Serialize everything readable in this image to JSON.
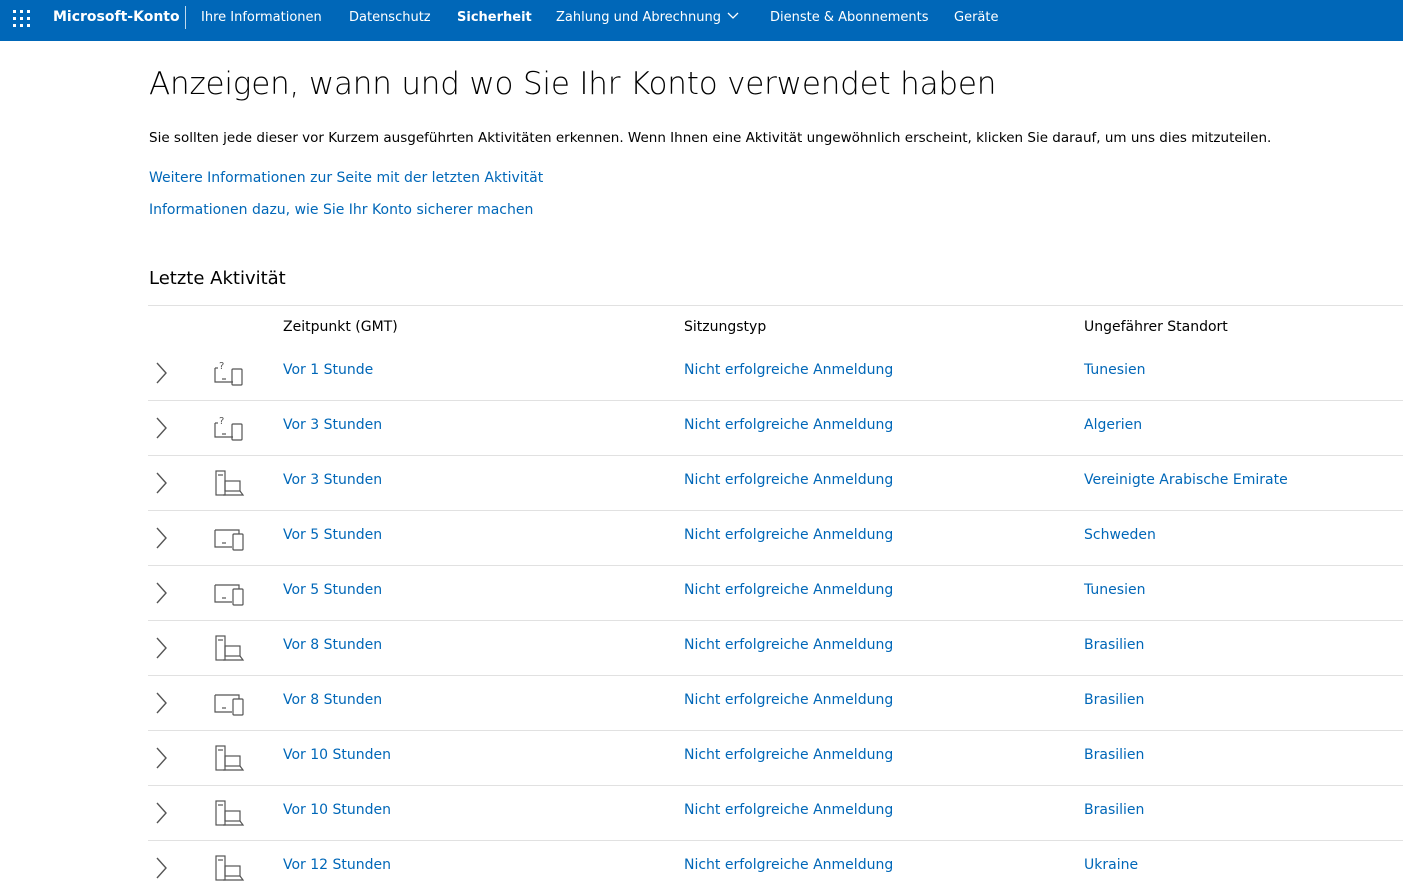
{
  "header": {
    "brand": "Microsoft-Konto",
    "nav": [
      {
        "label": "Ihre Informationen",
        "active": false
      },
      {
        "label": "Datenschutz",
        "active": false
      },
      {
        "label": "Sicherheit",
        "active": true
      },
      {
        "label": "Zahlung und Abrechnung",
        "active": false,
        "dropdown": true
      },
      {
        "label": "Dienste & Abonnements",
        "active": false
      },
      {
        "label": "Geräte",
        "active": false
      }
    ],
    "colors": {
      "bar": "#0067b8",
      "text": "#ffffff"
    }
  },
  "main": {
    "title": "Anzeigen, wann und wo Sie Ihr Konto verwendet haben",
    "intro": "Sie sollten jede dieser vor Kurzem ausgeführten Aktivitäten erkennen. Wenn Ihnen eine Aktivität ungewöhnlich erscheint, klicken Sie darauf, um uns dies mitzuteilen.",
    "links": [
      "Weitere Informationen zur Seite mit der letzten Aktivität",
      "Informationen dazu, wie Sie Ihr Konto sicherer machen"
    ],
    "section_title": "Letzte Aktivität",
    "link_color": "#0067b8"
  },
  "table": {
    "headers": {
      "time": "Zeitpunkt (GMT)",
      "type": "Sitzungstyp",
      "location": "Ungefährer Standort"
    },
    "rows": [
      {
        "icon": "unknown-device-icon",
        "time": "Vor 1 Stunde",
        "type": "Nicht erfolgreiche Anmeldung",
        "location": "Tunesien"
      },
      {
        "icon": "unknown-device-icon",
        "time": "Vor 3 Stunden",
        "type": "Nicht erfolgreiche Anmeldung",
        "location": "Algerien"
      },
      {
        "icon": "desktop-computer-icon",
        "time": "Vor 3 Stunden",
        "type": "Nicht erfolgreiche Anmeldung",
        "location": "Vereinigte Arabische Emirate"
      },
      {
        "icon": "laptop-phone-icon",
        "time": "Vor 5 Stunden",
        "type": "Nicht erfolgreiche Anmeldung",
        "location": "Schweden"
      },
      {
        "icon": "laptop-phone-icon",
        "time": "Vor 5 Stunden",
        "type": "Nicht erfolgreiche Anmeldung",
        "location": "Tunesien"
      },
      {
        "icon": "desktop-computer-icon",
        "time": "Vor 8 Stunden",
        "type": "Nicht erfolgreiche Anmeldung",
        "location": "Brasilien"
      },
      {
        "icon": "laptop-phone-icon",
        "time": "Vor 8 Stunden",
        "type": "Nicht erfolgreiche Anmeldung",
        "location": "Brasilien"
      },
      {
        "icon": "desktop-computer-icon",
        "time": "Vor 10 Stunden",
        "type": "Nicht erfolgreiche Anmeldung",
        "location": "Brasilien"
      },
      {
        "icon": "desktop-computer-icon",
        "time": "Vor 10 Stunden",
        "type": "Nicht erfolgreiche Anmeldung",
        "location": "Brasilien"
      },
      {
        "icon": "desktop-computer-icon",
        "time": "Vor 12 Stunden",
        "type": "Nicht erfolgreiche Anmeldung",
        "location": "Ukraine"
      }
    ]
  }
}
